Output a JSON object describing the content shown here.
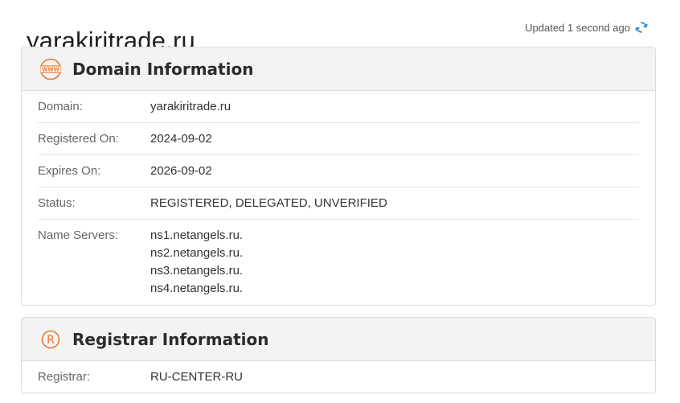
{
  "page": {
    "title": "yarakiritrade.ru",
    "updated_text": "Updated 1 second ago",
    "accent_color": "#e8772e",
    "refresh_icon": "refresh-icon"
  },
  "domain_card": {
    "icon": "www-icon",
    "title": "Domain Information",
    "rows": {
      "domain": {
        "label": "Domain:",
        "value": "yarakiritrade.ru"
      },
      "registered": {
        "label": "Registered On:",
        "value": "2024-09-02"
      },
      "expires": {
        "label": "Expires On:",
        "value": "2026-09-02"
      },
      "status": {
        "label": "Status:",
        "value": "REGISTERED, DELEGATED, UNVERIFIED"
      },
      "nameservers": {
        "label": "Name Servers:",
        "values": [
          "ns1.netangels.ru.",
          "ns2.netangels.ru.",
          "ns3.netangels.ru.",
          "ns4.netangels.ru."
        ]
      }
    }
  },
  "registrar_card": {
    "icon": "registered-icon",
    "title": "Registrar Information",
    "rows": {
      "registrar": {
        "label": "Registrar:",
        "value": "RU-CENTER-RU"
      }
    }
  }
}
